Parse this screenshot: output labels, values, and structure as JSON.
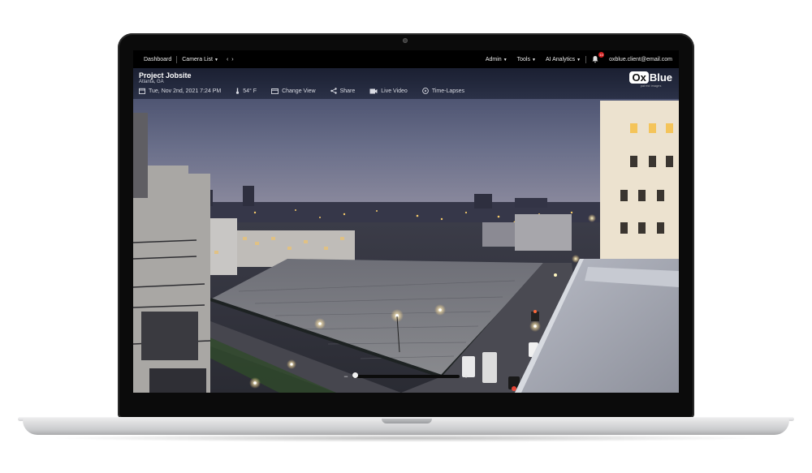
{
  "nav": {
    "dashboard": "Dashboard",
    "camera_list": "Camera List",
    "admin": "Admin",
    "tools": "Tools",
    "ai_analytics": "AI Analytics",
    "notification_count": "10",
    "user_email": "oxblue.client@email.com"
  },
  "header": {
    "project_name": "Project Jobsite",
    "location": "Atlanta, GA",
    "date_time": "Tue, Nov 2nd, 2021 7:24 PM",
    "temperature": "54° F",
    "change_view": "Change View",
    "share": "Share",
    "live_video": "Live Video",
    "time_lapses": "Time-Lapses"
  },
  "logo": {
    "ox": "Ox",
    "blue": "Blue",
    "tagline": "paired images"
  },
  "timeline": {
    "zoom_out": "−",
    "zoom_in": "+",
    "position_fraction": 0.0
  },
  "colors": {
    "nav_bg": "#000000",
    "header_bg": "#252b40",
    "notification_badge": "#d21f1f",
    "dusk_sky": "#5c6382"
  }
}
